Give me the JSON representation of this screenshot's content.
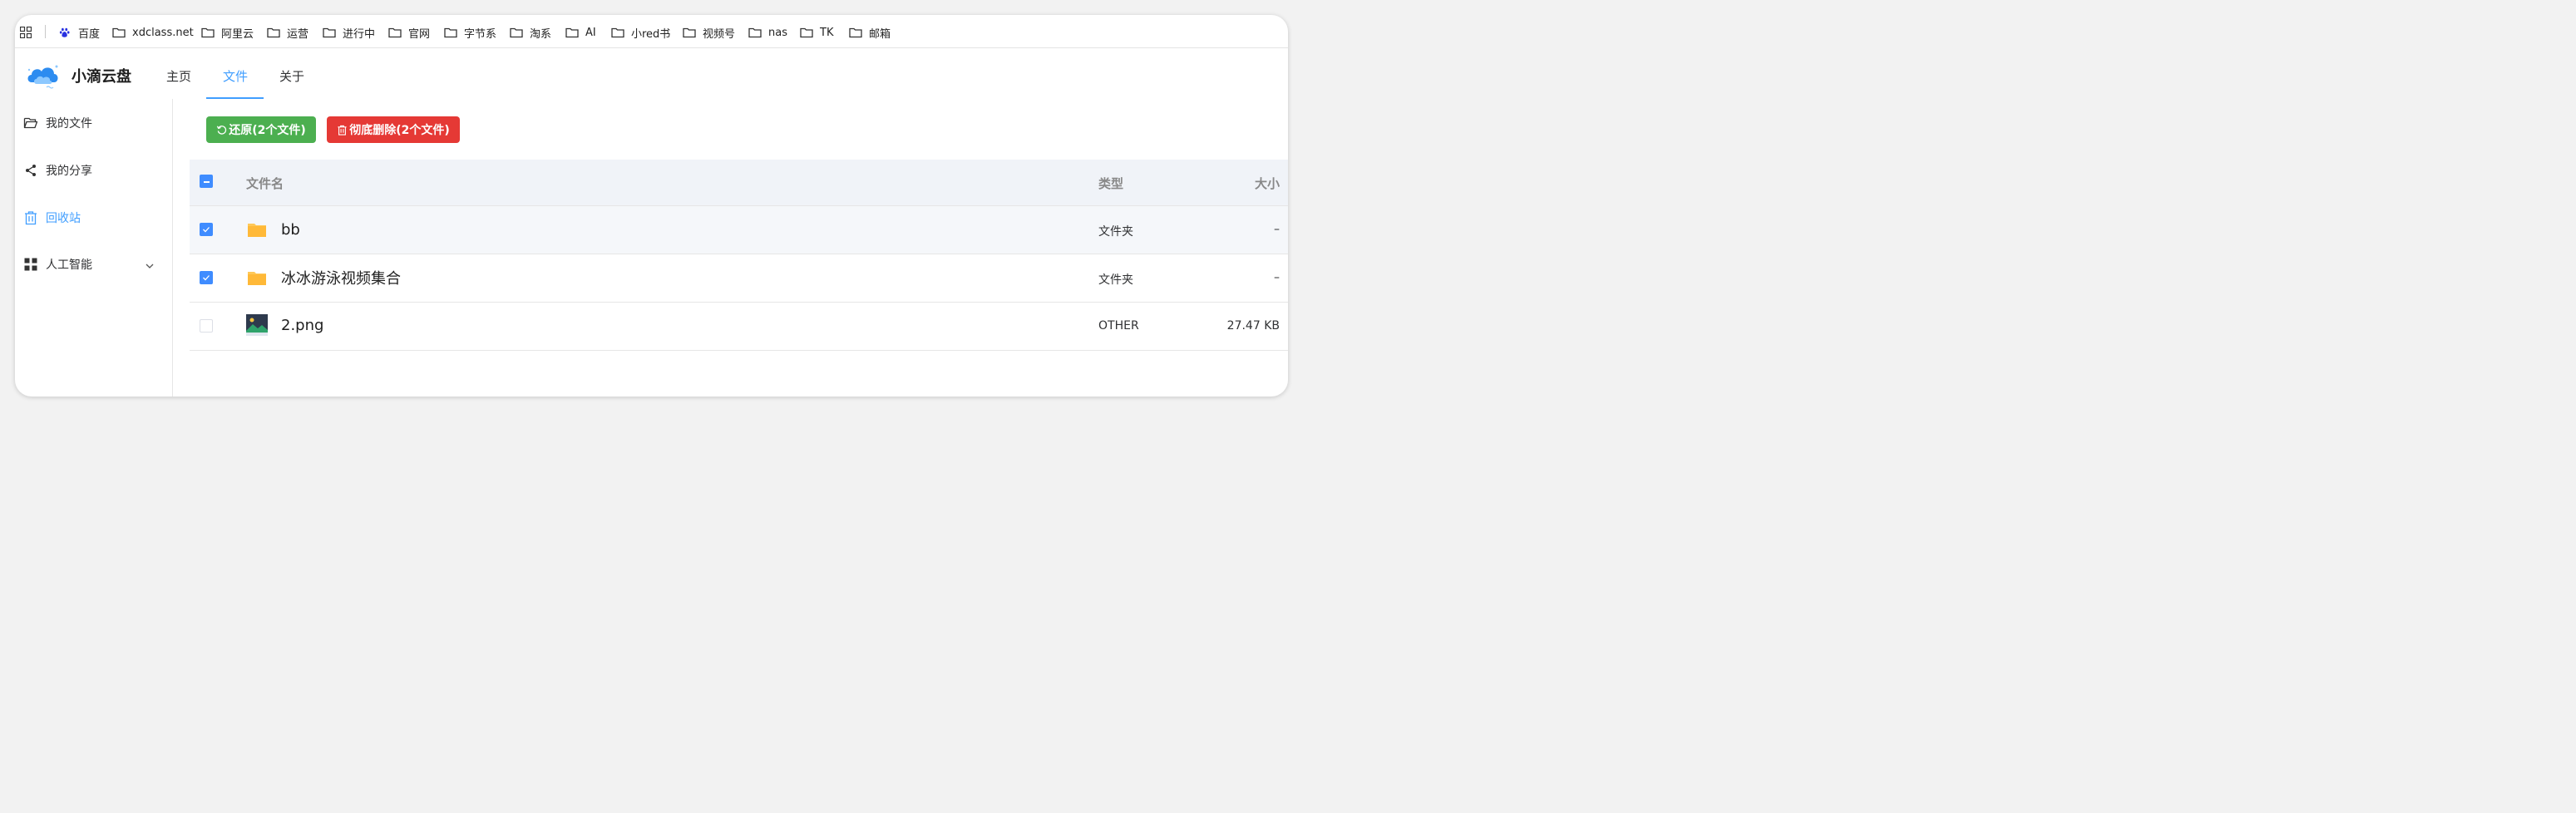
{
  "bookmarks_bar": {
    "items": [
      {
        "label": "百度",
        "icon": "baidu-paw-icon"
      },
      {
        "label": "xdclass.net",
        "icon": "folder-icon"
      },
      {
        "label": "阿里云",
        "icon": "folder-icon"
      },
      {
        "label": "运营",
        "icon": "folder-icon"
      },
      {
        "label": "进行中",
        "icon": "folder-icon"
      },
      {
        "label": "官网",
        "icon": "folder-icon"
      },
      {
        "label": "字节系",
        "icon": "folder-icon"
      },
      {
        "label": "淘系",
        "icon": "folder-icon"
      },
      {
        "label": "AI",
        "icon": "folder-icon"
      },
      {
        "label": "小red书",
        "icon": "folder-icon"
      },
      {
        "label": "视频号",
        "icon": "folder-icon"
      },
      {
        "label": "nas",
        "icon": "folder-icon"
      },
      {
        "label": "TK",
        "icon": "folder-icon"
      },
      {
        "label": "邮箱",
        "icon": "folder-icon"
      }
    ]
  },
  "header": {
    "app_title": "小滴云盘",
    "nav": [
      {
        "label": "主页",
        "active": false
      },
      {
        "label": "文件",
        "active": true
      },
      {
        "label": "关于",
        "active": false
      }
    ],
    "accent_color": "#409eff"
  },
  "sidebar": {
    "items": [
      {
        "label": "我的文件",
        "icon": "folder-open-icon",
        "active": false
      },
      {
        "label": "我的分享",
        "icon": "share-icon",
        "active": false
      },
      {
        "label": "回收站",
        "icon": "trash-icon",
        "active": true
      },
      {
        "label": "人工智能",
        "icon": "grid-icon",
        "active": false,
        "expandable": true
      }
    ]
  },
  "actions": {
    "restore_label": "还原(2个文件)",
    "delete_label": "彻底删除(2个文件)",
    "restore_color": "#4caf50",
    "delete_color": "#e53935"
  },
  "table": {
    "columns": {
      "name": "文件名",
      "type": "类型",
      "size": "大小"
    },
    "header_checkbox": "indeterminate",
    "rows": [
      {
        "name": "bb",
        "icon": "folder-icon",
        "type": "文件夹",
        "size": "–",
        "checked": true
      },
      {
        "name": "冰冰游泳视频集合",
        "icon": "folder-icon",
        "type": "文件夹",
        "size": "–",
        "checked": true
      },
      {
        "name": "2.png",
        "icon": "image-file-icon",
        "type": "OTHER",
        "size": "27.47 KB",
        "checked": false
      }
    ]
  }
}
